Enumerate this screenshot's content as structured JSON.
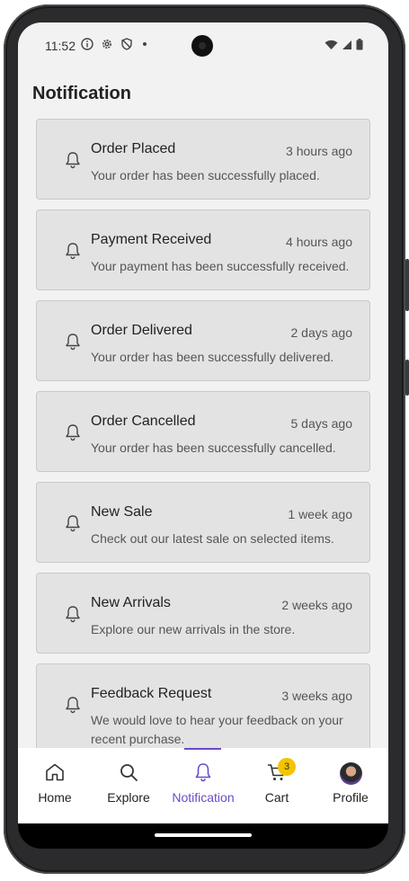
{
  "status_bar": {
    "time": "11:52",
    "icons_left": [
      "info-icon",
      "settings-icon",
      "shield-icon",
      "dot-icon"
    ],
    "icons_right": [
      "wifi-icon",
      "signal-icon",
      "battery-icon"
    ]
  },
  "page": {
    "title": "Notification"
  },
  "notifications": [
    {
      "title": "Order Placed",
      "time": "3 hours ago",
      "message": "Your order has been successfully placed."
    },
    {
      "title": "Payment Received",
      "time": "4 hours ago",
      "message": "Your payment has been successfully received."
    },
    {
      "title": "Order Delivered",
      "time": "2 days ago",
      "message": "Your order has been successfully delivered."
    },
    {
      "title": "Order Cancelled",
      "time": "5 days ago",
      "message": "Your order has been successfully cancelled."
    },
    {
      "title": "New Sale",
      "time": "1 week ago",
      "message": "Check out our latest sale on selected items."
    },
    {
      "title": "New Arrivals",
      "time": "2 weeks ago",
      "message": "Explore our new arrivals in the store."
    },
    {
      "title": "Feedback Request",
      "time": "3 weeks ago",
      "message": "We would love to hear your feedback on your recent purchase."
    }
  ],
  "bottom_nav": {
    "items": [
      {
        "label": "Home",
        "icon": "home-icon"
      },
      {
        "label": "Explore",
        "icon": "search-icon"
      },
      {
        "label": "Notification",
        "icon": "bell-icon"
      },
      {
        "label": "Cart",
        "icon": "cart-icon"
      },
      {
        "label": "Profile",
        "icon": "avatar"
      }
    ],
    "active": "Notification",
    "cart_badge": "3"
  },
  "colors": {
    "accent": "#6a4bc9",
    "badge": "#f4c400",
    "card_bg": "#e3e3e3",
    "screen_bg": "#f2f2f2"
  }
}
